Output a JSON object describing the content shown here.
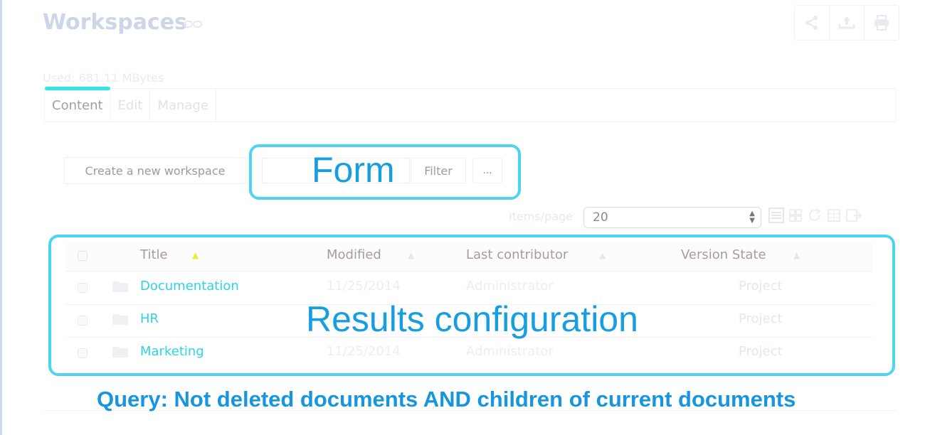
{
  "page": {
    "title": "Workspaces",
    "used": "Used: 681.11 MBytes"
  },
  "tabs": [
    "Content",
    "Edit",
    "Manage"
  ],
  "toolbar": {
    "create_label": "Create a new workspace",
    "search_value": "",
    "filter_label": "Filter",
    "more_label": "..."
  },
  "pagination": {
    "items_per_page_label": "Items/page",
    "items_per_page_value": "20"
  },
  "table": {
    "columns": [
      "Title",
      "Modified",
      "Last contributor",
      "Version State"
    ],
    "sorted_column": "Title",
    "rows": [
      {
        "title": "Documentation",
        "modified": "11/25/2014",
        "contributor": "Administrator",
        "state": "Project"
      },
      {
        "title": "HR",
        "modified": "11/25/2014",
        "contributor": "Administrator",
        "state": "Project"
      },
      {
        "title": "Marketing",
        "modified": "11/25/2014",
        "contributor": "Administrator",
        "state": "Project"
      }
    ]
  },
  "annotations": {
    "form": "Form",
    "results": "Results configuration",
    "query": "Query: Not deleted documents AND children of current documents"
  },
  "colors": {
    "annotation_border": "#4fd4ef",
    "annotation_text": "#169ee0",
    "active_tab_underline": "#2ee7ea",
    "link": "#2fd3e3",
    "sort_active": "#f2ea3c"
  }
}
